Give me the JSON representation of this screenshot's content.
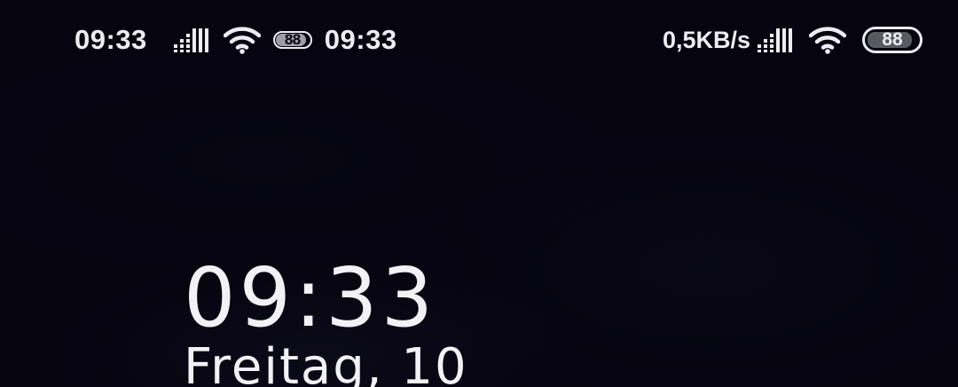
{
  "status_bar_left": {
    "time": "09:33",
    "signal_icon": "cellular-signal-icon",
    "wifi_icon": "wifi-icon",
    "battery_level": "88",
    "time_secondary": "09:33"
  },
  "status_bar_right": {
    "network_speed": "0,5KB/s",
    "signal_icon": "cellular-signal-icon",
    "wifi_icon": "wifi-icon",
    "battery_level": "88"
  },
  "lock_screen": {
    "clock": "09:33",
    "date": "Freitag, 10"
  },
  "colors": {
    "background": "#05040f",
    "foreground": "#ececf2"
  }
}
